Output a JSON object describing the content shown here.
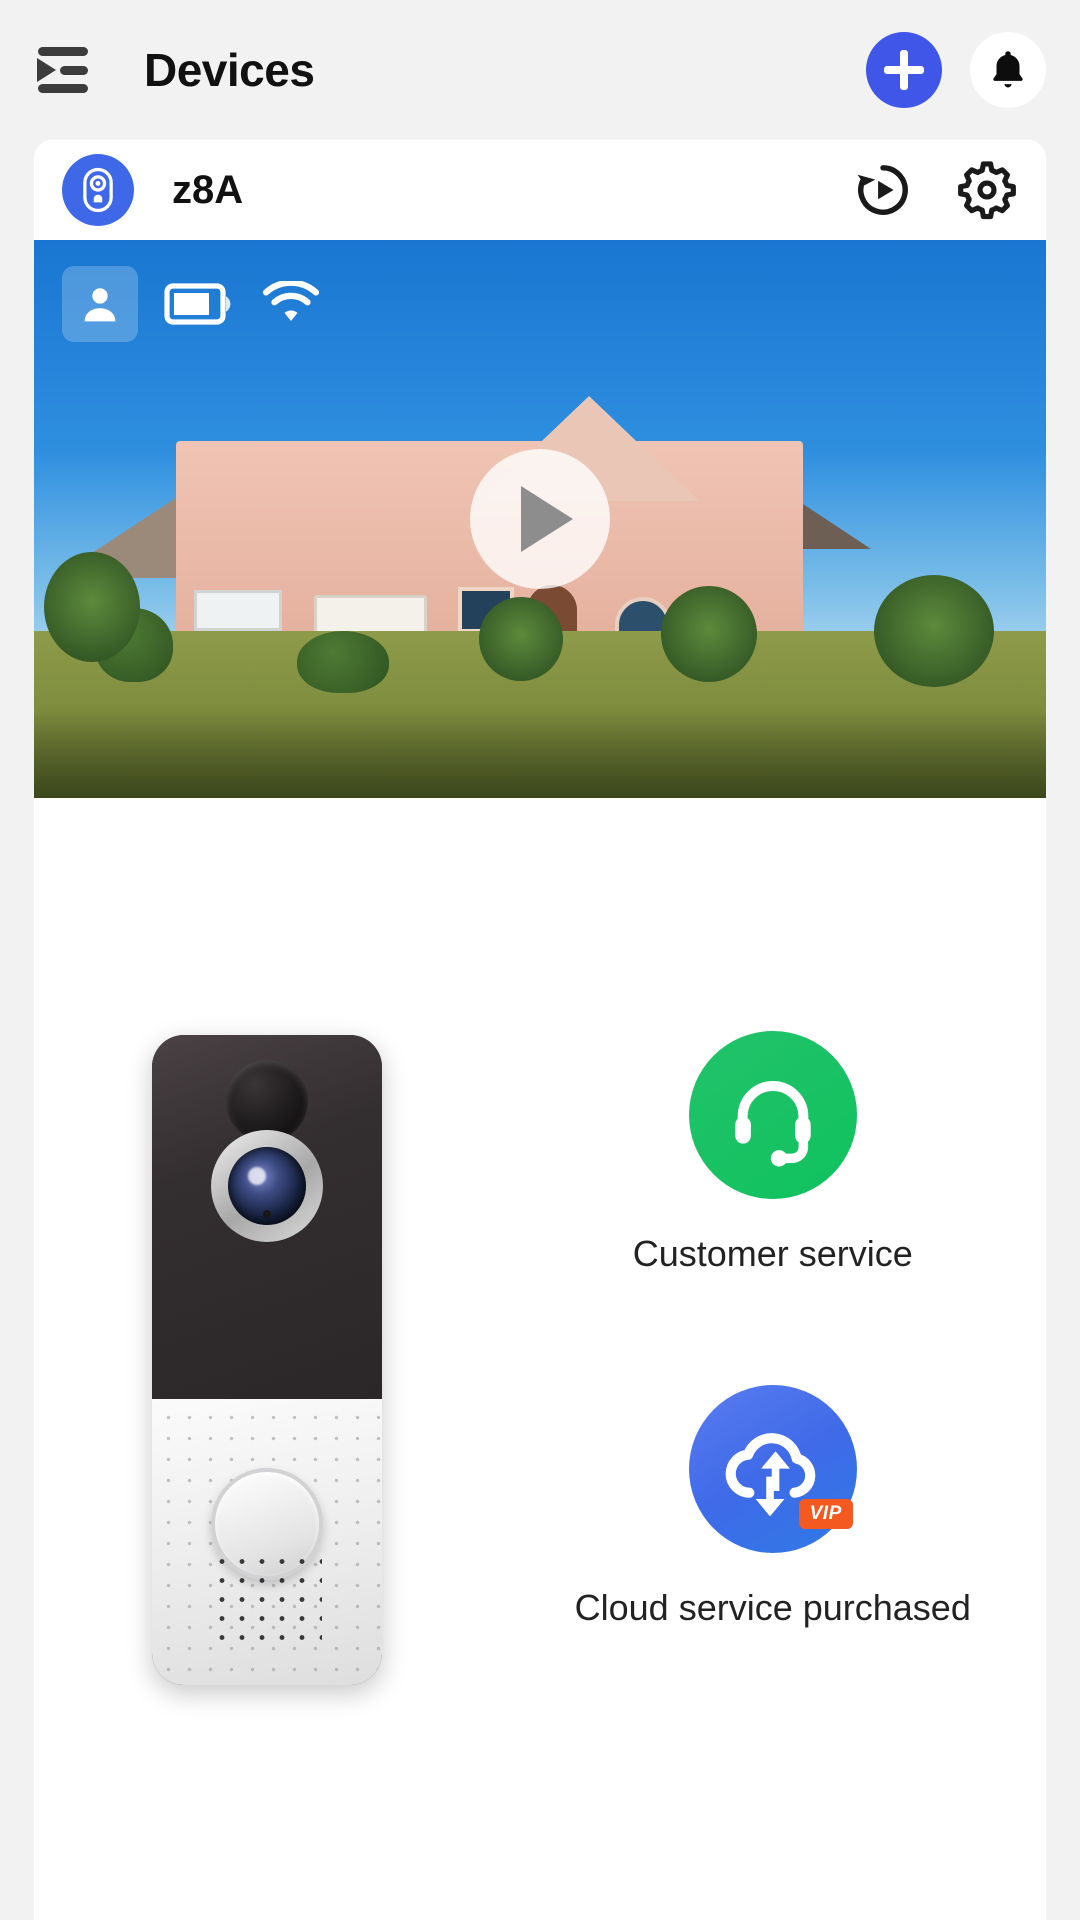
{
  "appbar": {
    "menu_icon": "menu-list-icon",
    "title": "Devices",
    "add_icon": "plus-icon",
    "bell_icon": "bell-icon"
  },
  "device": {
    "badge_icon": "doorbell-icon",
    "name": "z8A",
    "playback_icon": "playback-history-icon",
    "settings_icon": "gear-icon"
  },
  "video": {
    "status_icons": [
      "person-icon",
      "battery-icon",
      "wifi-icon"
    ],
    "battery_level_percent": 75,
    "play_icon": "play-icon"
  },
  "services": [
    {
      "icon": "headset-icon",
      "label": "Customer service",
      "color": "#18c263"
    },
    {
      "icon": "cloud-sync-icon",
      "label": "Cloud service purchased",
      "color": "#3f6ae8",
      "badge": "VIP",
      "badge_color": "#f4591f"
    }
  ],
  "colors": {
    "accent_blue": "#3f56e8",
    "device_blue": "#3f68e8",
    "green": "#18c263",
    "orange": "#f4591f",
    "page_bg": "#f2f2f2"
  }
}
